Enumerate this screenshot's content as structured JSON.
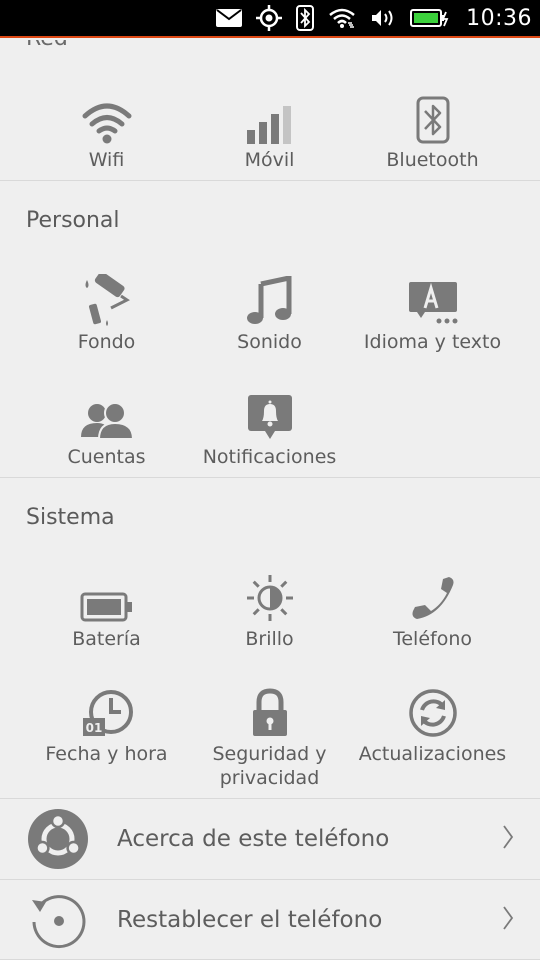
{
  "status_bar": {
    "time": "10:36"
  },
  "sections": {
    "red": {
      "title": "Red",
      "items": [
        {
          "label": "Wifi",
          "icon": "wifi-icon"
        },
        {
          "label": "Móvil",
          "icon": "cellular-signal-icon"
        },
        {
          "label": "Bluetooth",
          "icon": "bluetooth-icon"
        }
      ]
    },
    "personal": {
      "title": "Personal",
      "items": [
        {
          "label": "Fondo",
          "icon": "paint-roller-icon"
        },
        {
          "label": "Sonido",
          "icon": "music-note-icon"
        },
        {
          "label": "Idioma y texto",
          "icon": "language-keyboard-icon"
        },
        {
          "label": "Cuentas",
          "icon": "accounts-icon"
        },
        {
          "label": "Notificaciones",
          "icon": "notification-bell-icon"
        }
      ]
    },
    "sistema": {
      "title": "Sistema",
      "items": [
        {
          "label": "Batería",
          "icon": "battery-icon"
        },
        {
          "label": "Brillo",
          "icon": "brightness-icon"
        },
        {
          "label": "Teléfono",
          "icon": "phone-icon"
        },
        {
          "label": "Fecha y hora",
          "icon": "clock-calendar-icon"
        },
        {
          "label": "Seguridad y privacidad",
          "icon": "padlock-icon"
        },
        {
          "label": "Actualizaciones",
          "icon": "update-icon"
        }
      ]
    }
  },
  "rows": [
    {
      "label": "Acerca de este teléfono",
      "icon": "ubuntu-logo-icon"
    },
    {
      "label": "Restablecer el teléfono",
      "icon": "reset-icon"
    }
  ],
  "colors": {
    "accent": "#dd4814",
    "icon": "#7a7a7a",
    "background": "#efefef",
    "text": "#5d5d5d"
  }
}
